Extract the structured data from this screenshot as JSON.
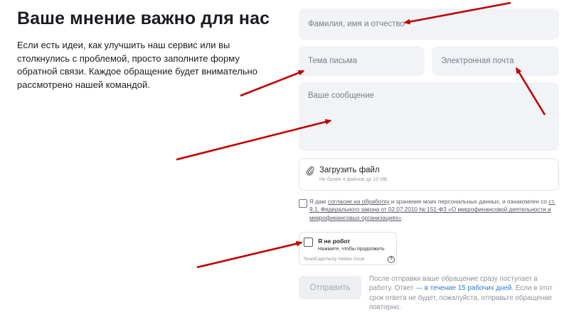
{
  "header": {
    "title": "Ваше мнение важно для нас",
    "intro": "Если есть идеи, как улучшить наш сервис или вы столкнулись с проблемой, просто заполните форму обратной связи. Каждое обращение будет внимательно рассмотрено нашей командой."
  },
  "form": {
    "name_placeholder": "Фамилия, имя и отчество",
    "subject_placeholder": "Тема письма",
    "email_placeholder": "Электронная почта",
    "message_placeholder": "Ваше сообщение",
    "upload_label": "Загрузить файл",
    "upload_hint": "Не более 4 файлов до 10 МБ",
    "consent_pre": "Я даю ",
    "consent_link": "согласие на обработку",
    "consent_mid": " и хранение моих персональных данных, и ознакомлен со ",
    "consent_law": "ст. 9.1. Федерального закона от 02.07.2010 № 151-ФЗ «О микрофинансовой деятельности и микрофинансовых организациях»",
    "consent_end": ".",
    "submit_label": "Отправить",
    "note_pre": "После отправки ваше обращение сразу поступает в работу. Ответ — ",
    "note_link": "в течение 15 рабочих дней",
    "note_post": ". Если в этот срок ответа не будет, пожалуйста, отправьте обращение повторно."
  },
  "captcha": {
    "title": "Я не робот",
    "subtitle": "Нажмите, чтобы продолжить",
    "brand": "SmartCaptcha by Yandex Cloud",
    "help": "?"
  },
  "colors": {
    "field_bg": "#f2f3f7",
    "annotation_arrow": "#c00000",
    "link": "#2f7fcf"
  },
  "icons": {
    "upload": "paperclip-icon",
    "captcha_help": "question-circle-icon"
  }
}
